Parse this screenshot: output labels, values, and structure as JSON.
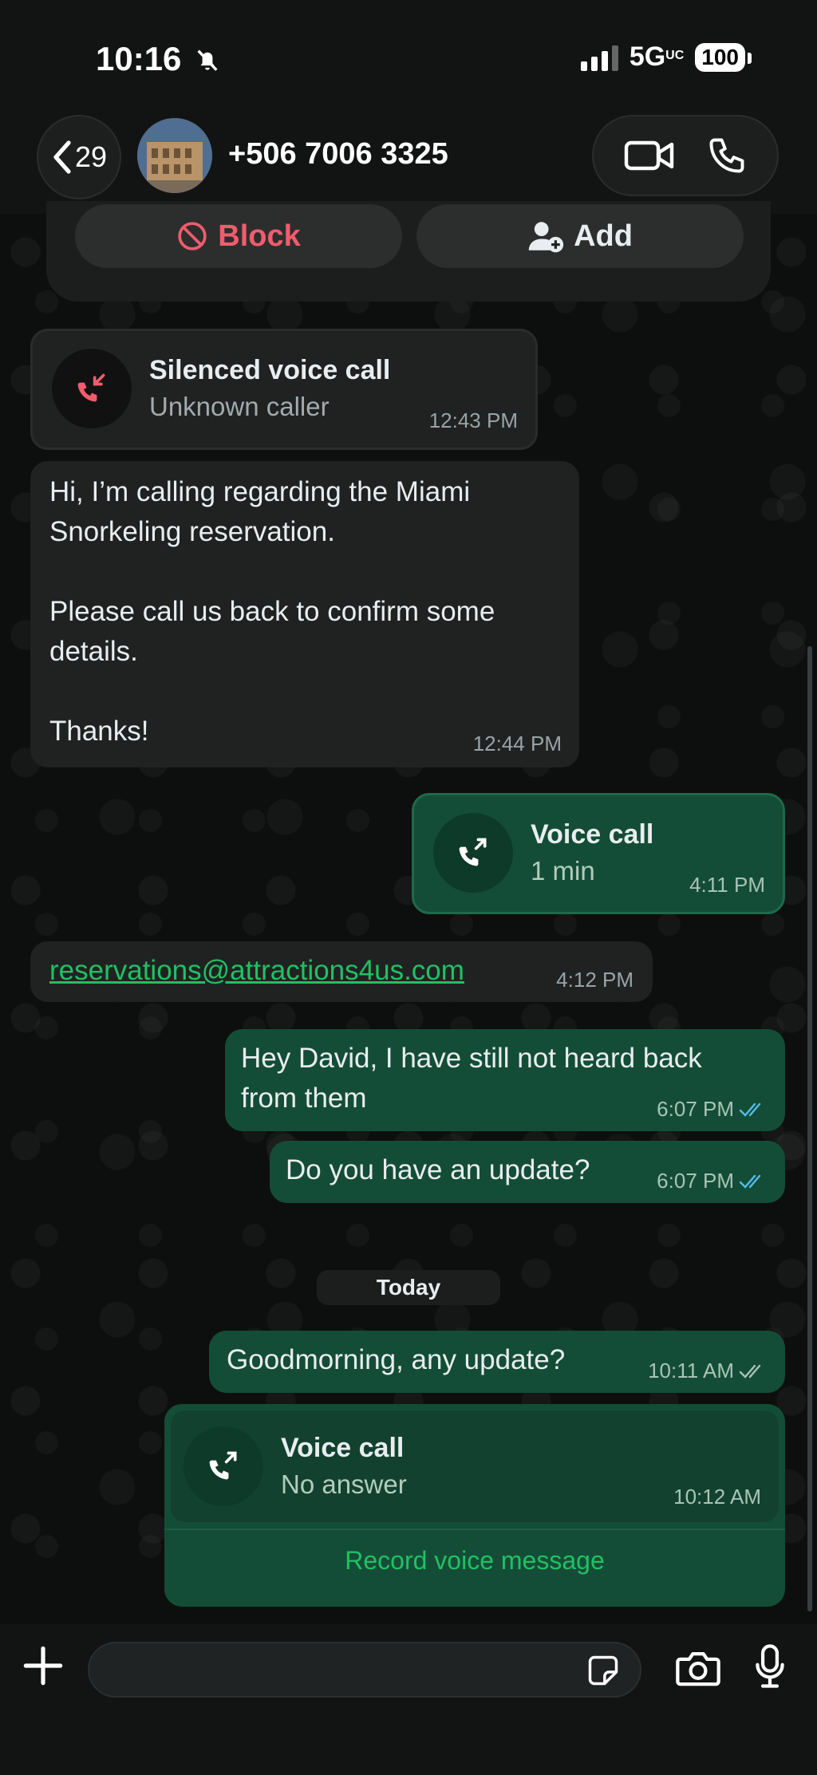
{
  "status_bar": {
    "time": "10:16",
    "network": "5G",
    "network_suffix": "UC",
    "battery": "100"
  },
  "header": {
    "back_count": "29",
    "contact_name": "+506 7006 3325"
  },
  "contact_card": {
    "block_label": "Block",
    "add_label": "Add"
  },
  "messages": [
    {
      "type": "call",
      "direction": "incoming",
      "title": "Silenced voice call",
      "subtitle": "Unknown caller",
      "time": "12:43 PM"
    },
    {
      "type": "text",
      "direction": "incoming",
      "lines": [
        "Hi, I’m calling regarding the Miami",
        "Snorkeling reservation.",
        "",
        "Please call us back to confirm some",
        "details.",
        "",
        "Thanks!"
      ],
      "time": "12:44 PM"
    },
    {
      "type": "call",
      "direction": "outgoing",
      "title": "Voice call",
      "subtitle": "1 min",
      "time": "4:11 PM"
    },
    {
      "type": "link",
      "direction": "incoming",
      "text": "reservations@attractions4us.com",
      "time": "4:12 PM"
    },
    {
      "type": "text",
      "direction": "outgoing",
      "lines": [
        "Hey David, I have still not heard back",
        "from them"
      ],
      "time": "6:07 PM",
      "status": "read"
    },
    {
      "type": "text",
      "direction": "outgoing",
      "lines": [
        "Do you have an update?"
      ],
      "time": "6:07 PM",
      "status": "read"
    },
    {
      "type": "text",
      "direction": "outgoing",
      "lines": [
        "Goodmorning, any update?"
      ],
      "time": "10:11 AM",
      "status": "delivered"
    },
    {
      "type": "call",
      "direction": "outgoing",
      "title": "Voice call",
      "subtitle": "No answer",
      "time": "10:12 AM",
      "action": "Record voice message"
    }
  ],
  "date_divider": "Today",
  "colors": {
    "outgoing_bubble": "#144d37",
    "incoming_bubble": "#202222",
    "read_ticks": "#53bdeb",
    "block_red": "#f15c6d",
    "accent_green": "#21c063"
  },
  "icons": [
    "chevron-left-icon",
    "video-call-icon",
    "phone-icon",
    "block-icon",
    "add-contact-icon",
    "missed-call-icon",
    "outgoing-call-icon",
    "double-check-icon",
    "plus-icon",
    "sticker-icon",
    "camera-icon",
    "mic-icon",
    "mute-bell-icon"
  ]
}
